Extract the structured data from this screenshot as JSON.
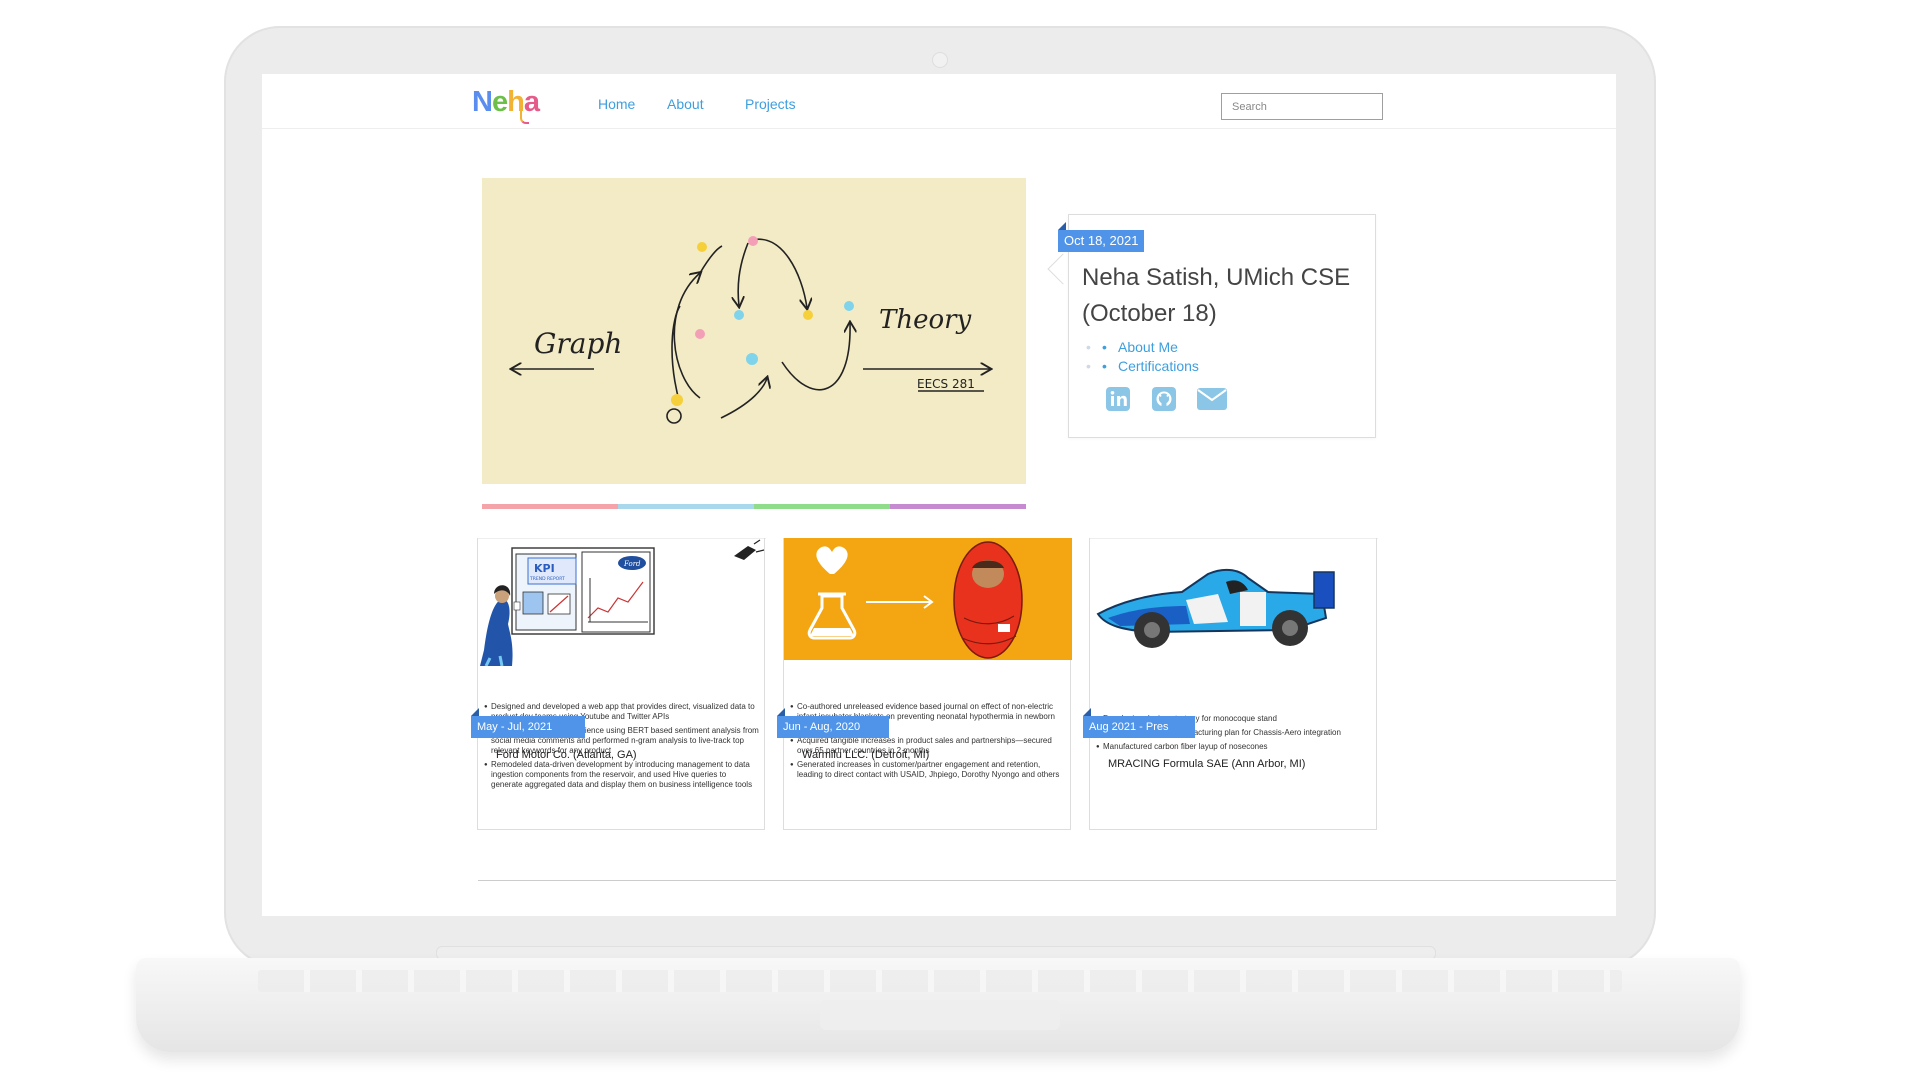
{
  "nav": {
    "logo_letters": [
      "N",
      "e",
      "h",
      "a"
    ],
    "links": [
      "Home",
      "About",
      "Projects"
    ],
    "search_placeholder": "Search"
  },
  "hero": {
    "left_word": "Graph",
    "right_word": "Theory",
    "course": "EECS 281",
    "colorbar_colors": [
      "#f4a3a8",
      "#a9d7ec",
      "#8fdc8b",
      "#c58ad0"
    ]
  },
  "profile": {
    "date": "Oct 18, 2021",
    "name_line1": "Neha Satish, UMich CSE",
    "name_line2": "(October 18)",
    "links": [
      "About Me",
      "Certifications"
    ],
    "social_icons": [
      "linkedin-icon",
      "github-icon",
      "email-icon"
    ],
    "accent": "#4f94e8",
    "icon_color": "#8cc6e6"
  },
  "experience": [
    {
      "date": "May - Jul, 2021",
      "title": "Ford Motor Co. (Atlanta, GA)",
      "board_label": "KPI",
      "board_sub": "TREND REPORT",
      "brand": "Ford",
      "bullets": [
        "Designed and developed a web app that provides direct, visualized data to product dev teams using Youtube and Twitter APIs",
        "Quantified customer experience using BERT based sentiment analysis from social media comments and performed n-gram analysis to live-track top relevant keywords for any product",
        "Remodeled data-driven development by introducing management to data ingestion components from the reservoir, and used Hive queries to generate aggregated data and display them on business intelligence tools"
      ]
    },
    {
      "date": "Jun - Aug, 2020",
      "title": "Warmilu LLC. (Detroit, MI)",
      "bullets": [
        "Co-authored unreleased evidence based journal on effect of non-electric infant incubator blankets on preventing neonatal hypothermia in newborn nurseries or NICU's",
        "Acquired tangible increases in product sales and partnerships—secured over 65 partner countries in 2 months",
        "Generated increases in customer/partner engagement and retention, leading to direct contact with USAID, Jhpiego, Dorothy Nyongo and others"
      ]
    },
    {
      "date": "Aug 2021 - Pres",
      "title": "MRACING Formula SAE (Ann Arbor, MI)",
      "bullets": [
        "Developing design strategy for monocoque stand",
        "Developing a CNC manufacturing plan for Chassis-Aero integration",
        "Manufactured carbon fiber layup of nosecones"
      ]
    }
  ]
}
